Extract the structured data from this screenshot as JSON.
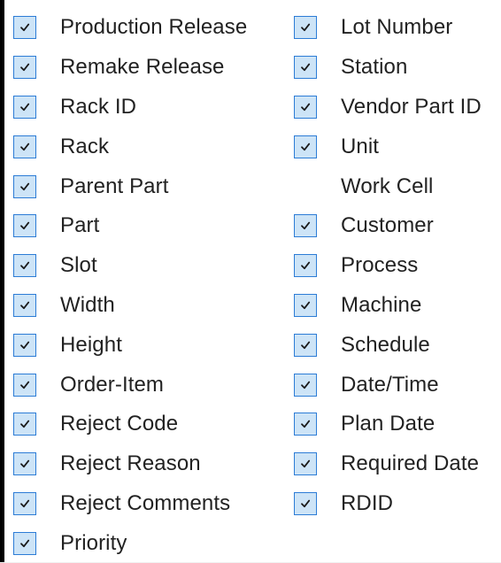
{
  "columns": {
    "left": [
      {
        "label": "Production Release",
        "checked": true
      },
      {
        "label": "Remake Release",
        "checked": true
      },
      {
        "label": "Rack ID",
        "checked": true
      },
      {
        "label": "Rack",
        "checked": true
      },
      {
        "label": "Parent Part",
        "checked": true
      },
      {
        "label": "Part",
        "checked": true
      },
      {
        "label": "Slot",
        "checked": true
      },
      {
        "label": "Width",
        "checked": true
      },
      {
        "label": "Height",
        "checked": true
      },
      {
        "label": "Order-Item",
        "checked": true
      },
      {
        "label": "Reject Code",
        "checked": true
      },
      {
        "label": "Reject Reason",
        "checked": true
      },
      {
        "label": "Reject Comments",
        "checked": true
      },
      {
        "label": "Priority",
        "checked": true
      }
    ],
    "right": [
      {
        "label": "Lot Number",
        "checked": true
      },
      {
        "label": "Station",
        "checked": true
      },
      {
        "label": "Vendor Part ID",
        "checked": true
      },
      {
        "label": "Unit",
        "checked": true
      },
      {
        "label": "Work Cell",
        "checked": false
      },
      {
        "label": "Customer",
        "checked": true
      },
      {
        "label": "Process",
        "checked": true
      },
      {
        "label": "Machine",
        "checked": true
      },
      {
        "label": "Schedule",
        "checked": true
      },
      {
        "label": "Date/Time",
        "checked": true
      },
      {
        "label": "Plan Date",
        "checked": true
      },
      {
        "label": "Required Date",
        "checked": true
      },
      {
        "label": "RDID",
        "checked": true
      }
    ]
  },
  "colors": {
    "checkbox_fill": "#cde4f7",
    "checkbox_border": "#2c7cd6",
    "checkmark": "#1a1a1a"
  }
}
